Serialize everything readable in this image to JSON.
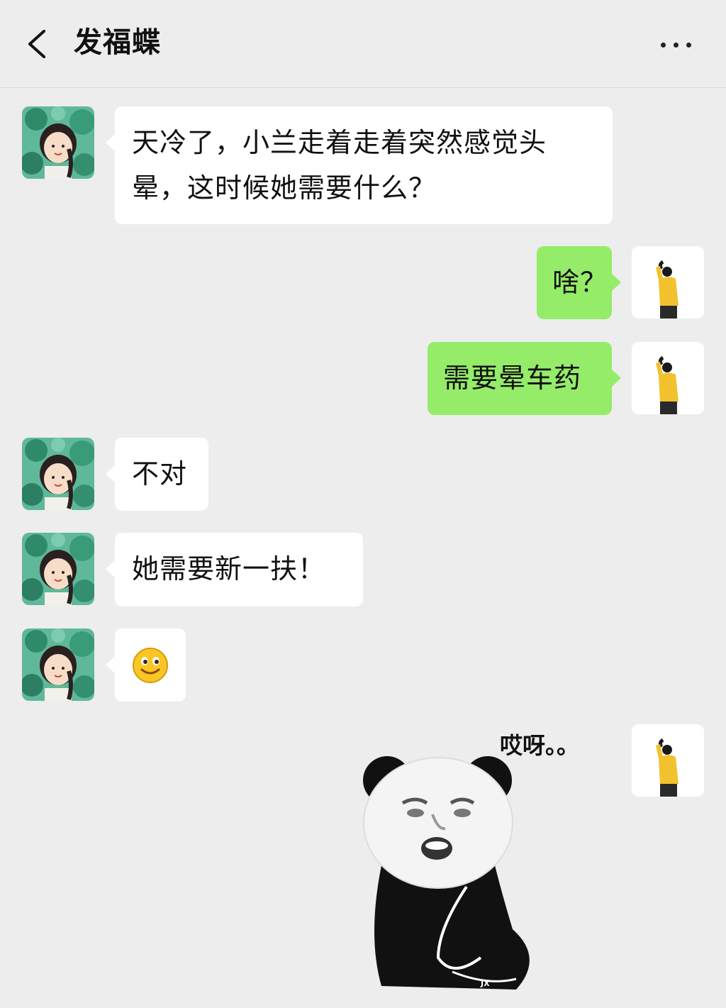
{
  "header": {
    "title": "发福蝶",
    "back_icon": "chevron-left-icon",
    "more_icon": "more-horizontal-icon"
  },
  "messages": [
    {
      "side": "left",
      "type": "text",
      "text": "天冷了，小兰走着走着突然感觉头晕，这时候她需要什么？"
    },
    {
      "side": "right",
      "type": "text",
      "text": "啥？"
    },
    {
      "side": "right",
      "type": "text",
      "text": "需要晕车药"
    },
    {
      "side": "left",
      "type": "text",
      "text": "不对"
    },
    {
      "side": "left",
      "type": "text",
      "text": "她需要新一扶！"
    },
    {
      "side": "left",
      "type": "emoji",
      "emoji": "🙂",
      "icon": "smiley-face-icon"
    },
    {
      "side": "right",
      "type": "sticker",
      "caption": "哎呀。。",
      "watermark": "JX",
      "icon": "panda-meme-sticker"
    }
  ],
  "colors": {
    "background": "#ededed",
    "incoming_bubble": "#ffffff",
    "outgoing_bubble": "#95ec69"
  }
}
